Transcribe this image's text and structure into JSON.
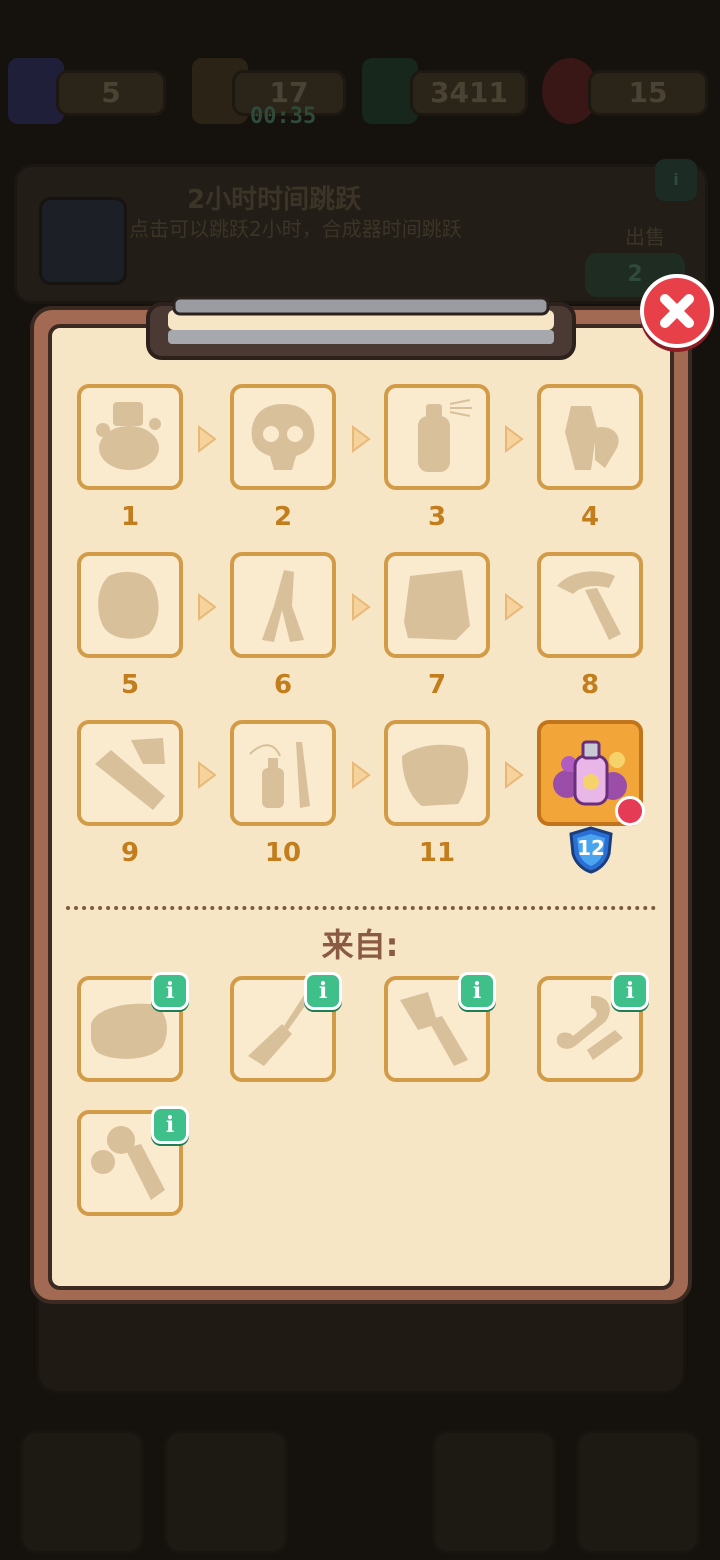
{
  "hud": {
    "tickets": "5",
    "energy": "17",
    "energy_timer": "00:35",
    "cash": "3411",
    "gems": "15"
  },
  "task": {
    "level": "2",
    "title": "2小时时间跳跃",
    "description": "点击可以跳跃2小时，合成器时间跳跃",
    "button_label": "出售",
    "button_value": "2"
  },
  "chain": {
    "items": [
      {
        "number": "1",
        "icon": "dust-pile-icon"
      },
      {
        "number": "2",
        "icon": "skull-icon"
      },
      {
        "number": "3",
        "icon": "spray-bottle-icon"
      },
      {
        "number": "4",
        "icon": "bottles-icon"
      },
      {
        "number": "5",
        "icon": "sponge-icon"
      },
      {
        "number": "6",
        "icon": "tweezers-icon"
      },
      {
        "number": "7",
        "icon": "cloth-icon"
      },
      {
        "number": "8",
        "icon": "hammer-icon"
      },
      {
        "number": "9",
        "icon": "brush-icon"
      },
      {
        "number": "10",
        "icon": "perfume-brush-icon"
      },
      {
        "number": "11",
        "icon": "glove-icon"
      },
      {
        "number": "",
        "icon": "perfume-bottle-icon",
        "level": "12",
        "unlocked": true
      }
    ]
  },
  "source": {
    "heading": "来自:",
    "items": [
      {
        "icon": "soap-bar-icon",
        "info": "i"
      },
      {
        "icon": "screwdriver-icon",
        "info": "i"
      },
      {
        "icon": "trowel-icon",
        "info": "i"
      },
      {
        "icon": "clamp-icon",
        "info": "i"
      },
      {
        "icon": "roller-icon",
        "info": "i"
      }
    ]
  },
  "colors": {
    "paper": "#f7e6c6",
    "tile_border": "#d29b48",
    "number_text": "#c27d1c",
    "info_badge": "#3fc08a",
    "close_button": "#e84049"
  }
}
